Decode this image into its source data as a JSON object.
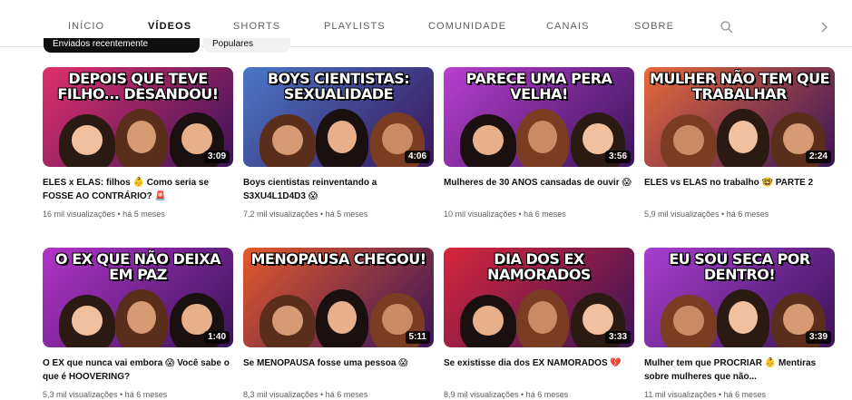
{
  "tabs": [
    {
      "label": "INÍCIO"
    },
    {
      "label": "VÍDEOS"
    },
    {
      "label": "SHORTS"
    },
    {
      "label": "PLAYLISTS"
    },
    {
      "label": "COMUNIDADE"
    },
    {
      "label": "CANAIS"
    },
    {
      "label": "SOBRE"
    }
  ],
  "icons": {
    "search": "search-icon",
    "next": "chevron-right-icon"
  },
  "chips": {
    "selected": "Enviados recentemente",
    "other": "Populares"
  },
  "videos": [
    {
      "thumb_text": "DEPOIS QUE TEVE FILHO... DESANDOU!",
      "duration": "3:09",
      "title": "ELES x ELAS: filhos 👶 Como seria se FOSSE AO CONTRÁRIO? 🚨",
      "meta": "16 mil visualizações • há 5 meses",
      "bg": "#e0306b"
    },
    {
      "thumb_text": "BOYS CIENTISTAS: SEXUALIDADE",
      "duration": "4:06",
      "title": "Boys cientistas reinventando a S3XU4L1D4D3 😱",
      "meta": "7,2 mil visualizações • há 5 meses",
      "bg": "#4a78c8"
    },
    {
      "thumb_text": "PARECE UMA PERA VELHA!",
      "duration": "3:56",
      "title": "Mulheres de 30 ANOS cansadas de ouvir 😱",
      "meta": "10 mil visualizações • há 6 meses",
      "bg": "#b93fd1"
    },
    {
      "thumb_text": "MULHER NÃO TEM QUE TRABALHAR",
      "duration": "2:24",
      "title": "ELES vs ELAS no trabalho 🤓 PARTE 2",
      "meta": "5,9 mil visualizações • há 6 meses",
      "bg": "#e86a3a"
    },
    {
      "thumb_text": "O EX QUE NÃO DEIXA EM PAZ",
      "duration": "1:40",
      "title": "O EX que nunca vai embora 😱 Você sabe o que é HOOVERING?",
      "meta": "5,3 mil visualizações • há 6 meses",
      "bg": "#b235c9"
    },
    {
      "thumb_text": "MENOPAUSA CHEGOU!",
      "duration": "5:11",
      "title": "Se MENOPAUSA fosse uma pessoa 😱",
      "meta": "8,3 mil visualizações • há 6 meses",
      "bg": "#e45a2a"
    },
    {
      "thumb_text": "DIA DOS EX NAMORADOS",
      "duration": "3:33",
      "title": "Se existisse dia dos EX NAMORADOS 💔",
      "meta": "8,9 mil visualizações • há 6 meses",
      "bg": "#d8263a"
    },
    {
      "thumb_text": "EU SOU SECA POR DENTRO!",
      "duration": "3:39",
      "title": "Mulher tem que PROCRIAR 👶 Mentiras sobre mulheres que não...",
      "meta": "11 mil visualizações • há 6 meses",
      "bg": "#a93ed0"
    }
  ]
}
